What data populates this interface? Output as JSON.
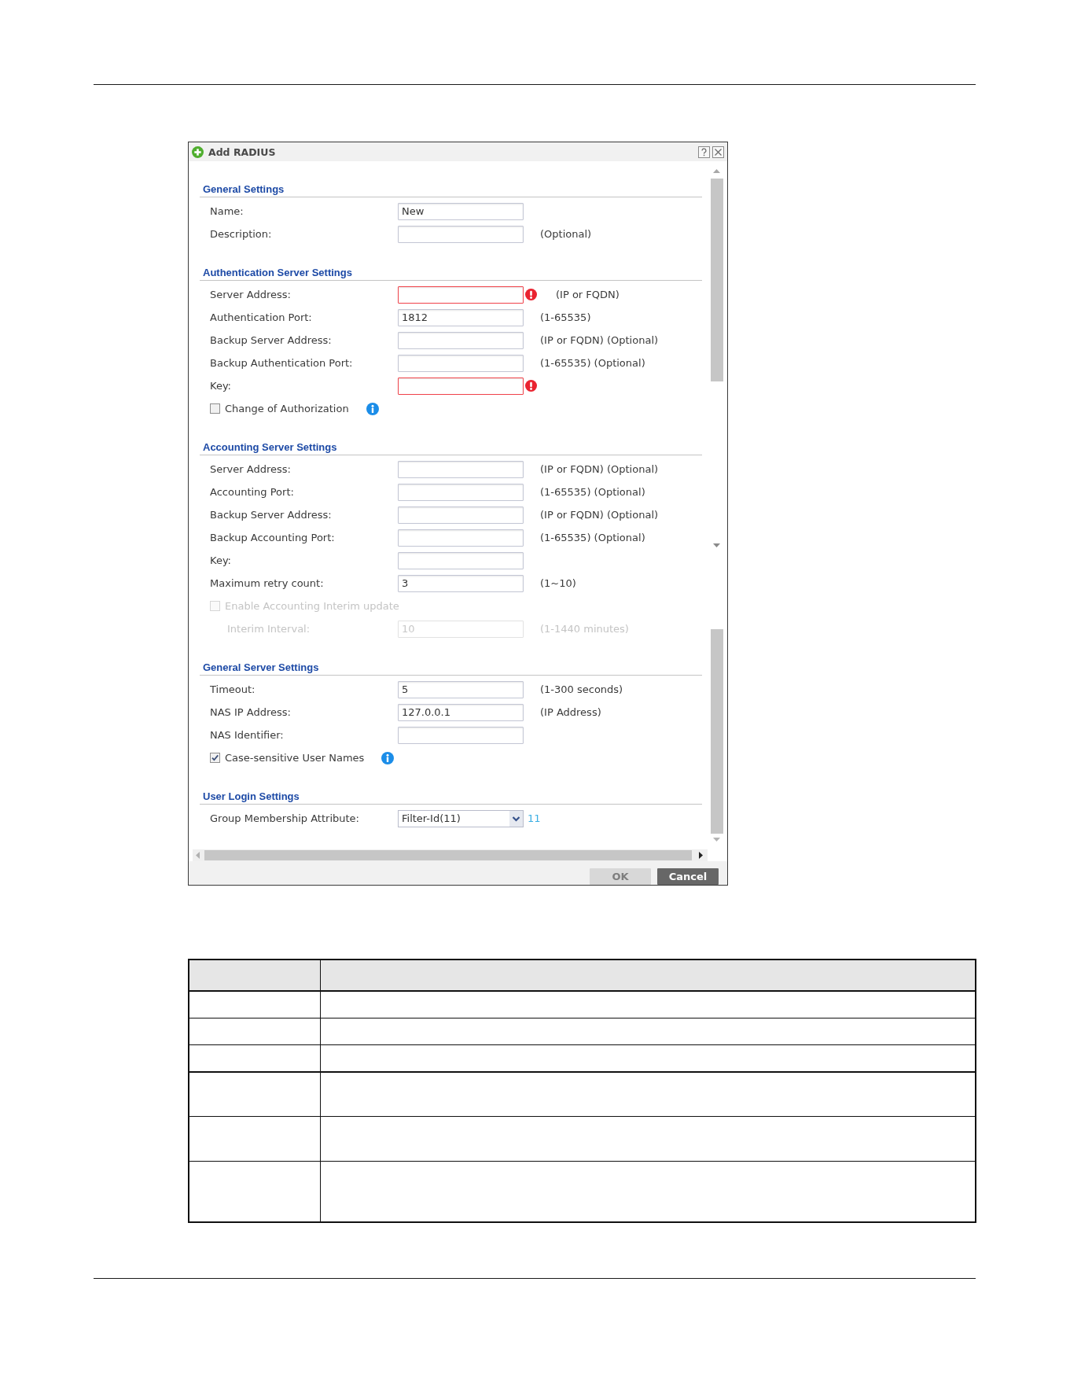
{
  "dialog": {
    "title": "Add RADIUS",
    "sections": [
      {
        "title": "General Settings",
        "rows": [
          {
            "kind": "field",
            "label": "Name:",
            "value": "New",
            "invalid": false,
            "disabled": false
          },
          {
            "kind": "field",
            "label": "Description:",
            "hint": "(Optional)",
            "invalid": false,
            "disabled": false
          }
        ]
      },
      {
        "title": "Authentication Server Settings",
        "rows": [
          {
            "kind": "field",
            "label": "Server Address:",
            "hint": "(IP or FQDN)",
            "invalid": true,
            "disabled": false
          },
          {
            "kind": "field",
            "label": "Authentication Port:",
            "value": "1812",
            "hint": "(1-65535)",
            "invalid": false,
            "disabled": false
          },
          {
            "kind": "field",
            "label": "Backup Server Address:",
            "hint": "(IP or FQDN) (Optional)",
            "invalid": false,
            "disabled": false
          },
          {
            "kind": "field",
            "label": "Backup Authentication Port:",
            "hint": "(1-65535) (Optional)",
            "invalid": false,
            "disabled": false
          },
          {
            "kind": "field",
            "label": "Key:",
            "invalid": true,
            "disabled": false
          },
          {
            "kind": "checkbox",
            "label": "Change of Authorization",
            "checked": false,
            "disabled": false,
            "info": true
          }
        ]
      },
      {
        "title": "Accounting Server Settings",
        "rows": [
          {
            "kind": "field",
            "label": "Server Address:",
            "hint": "(IP or FQDN) (Optional)",
            "invalid": false,
            "disabled": false
          },
          {
            "kind": "field",
            "label": "Accounting Port:",
            "hint": "(1-65535) (Optional)",
            "invalid": false,
            "disabled": false
          },
          {
            "kind": "field",
            "label": "Backup Server Address:",
            "hint": "(IP or FQDN) (Optional)",
            "invalid": false,
            "disabled": false
          },
          {
            "kind": "field",
            "label": "Backup Accounting Port:",
            "hint": "(1-65535) (Optional)",
            "invalid": false,
            "disabled": false
          },
          {
            "kind": "field",
            "label": "Key:",
            "invalid": false,
            "disabled": false
          },
          {
            "kind": "field",
            "label": "Maximum retry count:",
            "value": "3",
            "hint": "(1~10)",
            "invalid": false,
            "disabled": false
          },
          {
            "kind": "checkbox",
            "label": "Enable Accounting Interim update",
            "checked": false,
            "disabled": true,
            "info": false,
            "children": [
              {
                "kind": "field",
                "label": "Interim Interval:",
                "value": "10",
                "hint": "(1-1440 minutes)",
                "invalid": false,
                "disabled": true
              }
            ]
          }
        ]
      },
      {
        "title": "General Server Settings",
        "rows": [
          {
            "kind": "field",
            "label": "Timeout:",
            "value": "5",
            "hint": "(1-300 seconds)",
            "invalid": false,
            "disabled": false
          },
          {
            "kind": "field",
            "label": "NAS IP Address:",
            "value": "127.0.0.1",
            "hint": "(IP Address)",
            "invalid": false,
            "disabled": false
          },
          {
            "kind": "field",
            "label": "NAS Identifier:",
            "invalid": false,
            "disabled": false
          },
          {
            "kind": "checkbox",
            "label": "Case-sensitive User Names",
            "checked": true,
            "disabled": false,
            "info": true
          }
        ]
      },
      {
        "title": "User Login Settings",
        "rows": [
          {
            "kind": "select",
            "label": "Group Membership Attribute:",
            "value": "Filter-Id(11)",
            "suffix": "11"
          }
        ]
      }
    ],
    "buttons": [
      {
        "label": "OK",
        "disabled": true
      },
      {
        "label": "Cancel",
        "disabled": false
      }
    ]
  }
}
